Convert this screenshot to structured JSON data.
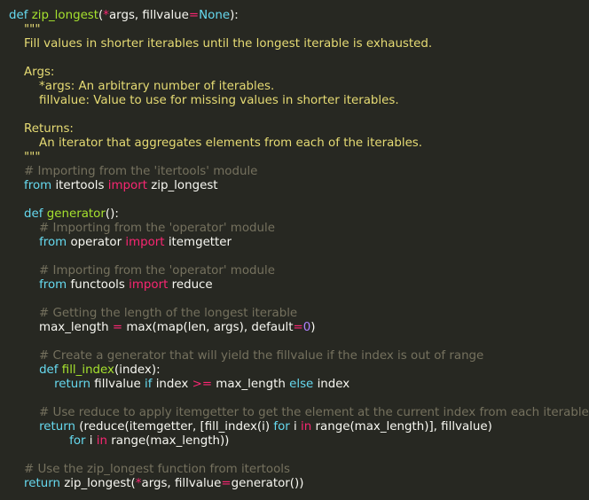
{
  "colors": {
    "background": "#272822",
    "keyword": "#66d9ef",
    "import": "#f92672",
    "function": "#a6e22e",
    "operator": "#f92672",
    "number": "#ae81ff",
    "string": "#e6db74",
    "comment": "#75715e",
    "text": "#f8f8f2"
  },
  "code": {
    "lines": [
      [
        {
          "t": "def ",
          "c": "kw"
        },
        {
          "t": "zip_longest",
          "c": "fn"
        },
        {
          "t": "(",
          "c": "plain"
        },
        {
          "t": "*",
          "c": "op"
        },
        {
          "t": "args, fillvalue",
          "c": "plain"
        },
        {
          "t": "=",
          "c": "op"
        },
        {
          "t": "None",
          "c": "kw"
        },
        {
          "t": "):",
          "c": "plain"
        }
      ],
      [
        {
          "t": "    \"\"\"",
          "c": "str"
        }
      ],
      [
        {
          "t": "    Fill values in shorter iterables until the longest iterable is exhausted.",
          "c": "str"
        }
      ],
      [
        {
          "t": "",
          "c": "plain"
        }
      ],
      [
        {
          "t": "    Args:",
          "c": "str"
        }
      ],
      [
        {
          "t": "        *args: An arbitrary number of iterables.",
          "c": "str"
        }
      ],
      [
        {
          "t": "        fillvalue: Value to use for missing values in shorter iterables.",
          "c": "str"
        }
      ],
      [
        {
          "t": "",
          "c": "plain"
        }
      ],
      [
        {
          "t": "    Returns:",
          "c": "str"
        }
      ],
      [
        {
          "t": "        An iterator that aggregates elements from each of the iterables.",
          "c": "str"
        }
      ],
      [
        {
          "t": "    \"\"\"",
          "c": "str"
        }
      ],
      [
        {
          "t": "    # Importing from the 'itertools' module",
          "c": "cm"
        }
      ],
      [
        {
          "t": "    ",
          "c": "plain"
        },
        {
          "t": "from",
          "c": "kw"
        },
        {
          "t": " itertools ",
          "c": "plain"
        },
        {
          "t": "import",
          "c": "imp"
        },
        {
          "t": " zip_longest",
          "c": "plain"
        }
      ],
      [
        {
          "t": "",
          "c": "plain"
        }
      ],
      [
        {
          "t": "    ",
          "c": "plain"
        },
        {
          "t": "def ",
          "c": "kw"
        },
        {
          "t": "generator",
          "c": "fn"
        },
        {
          "t": "():",
          "c": "plain"
        }
      ],
      [
        {
          "t": "        # Importing from the 'operator' module",
          "c": "cm"
        }
      ],
      [
        {
          "t": "        ",
          "c": "plain"
        },
        {
          "t": "from",
          "c": "kw"
        },
        {
          "t": " operator ",
          "c": "plain"
        },
        {
          "t": "import",
          "c": "imp"
        },
        {
          "t": " itemgetter",
          "c": "plain"
        }
      ],
      [
        {
          "t": "",
          "c": "plain"
        }
      ],
      [
        {
          "t": "        # Importing from the 'operator' module",
          "c": "cm"
        }
      ],
      [
        {
          "t": "        ",
          "c": "plain"
        },
        {
          "t": "from",
          "c": "kw"
        },
        {
          "t": " functools ",
          "c": "plain"
        },
        {
          "t": "import",
          "c": "imp"
        },
        {
          "t": " reduce",
          "c": "plain"
        }
      ],
      [
        {
          "t": "",
          "c": "plain"
        }
      ],
      [
        {
          "t": "        # Getting the length of the longest iterable",
          "c": "cm"
        }
      ],
      [
        {
          "t": "        max_length ",
          "c": "plain"
        },
        {
          "t": "=",
          "c": "op"
        },
        {
          "t": " max(map(len, args), default",
          "c": "plain"
        },
        {
          "t": "=",
          "c": "op"
        },
        {
          "t": "0",
          "c": "num"
        },
        {
          "t": ")",
          "c": "plain"
        }
      ],
      [
        {
          "t": "",
          "c": "plain"
        }
      ],
      [
        {
          "t": "        # Create a generator that will yield the fillvalue if the index is out of range",
          "c": "cm"
        }
      ],
      [
        {
          "t": "        ",
          "c": "plain"
        },
        {
          "t": "def ",
          "c": "kw"
        },
        {
          "t": "fill_index",
          "c": "fn"
        },
        {
          "t": "(index):",
          "c": "plain"
        }
      ],
      [
        {
          "t": "            ",
          "c": "plain"
        },
        {
          "t": "return",
          "c": "kw"
        },
        {
          "t": " fillvalue ",
          "c": "plain"
        },
        {
          "t": "if",
          "c": "kw"
        },
        {
          "t": " index ",
          "c": "plain"
        },
        {
          "t": ">=",
          "c": "op"
        },
        {
          "t": " max_length ",
          "c": "plain"
        },
        {
          "t": "else",
          "c": "kw"
        },
        {
          "t": " index",
          "c": "plain"
        }
      ],
      [
        {
          "t": "",
          "c": "plain"
        }
      ],
      [
        {
          "t": "        # Use reduce to apply itemgetter to get the element at the current index from each iterable",
          "c": "cm"
        }
      ],
      [
        {
          "t": "        ",
          "c": "plain"
        },
        {
          "t": "return",
          "c": "kw"
        },
        {
          "t": " (reduce(itemgetter, [fill_index(i) ",
          "c": "plain"
        },
        {
          "t": "for",
          "c": "kw"
        },
        {
          "t": " i ",
          "c": "plain"
        },
        {
          "t": "in",
          "c": "imp"
        },
        {
          "t": " range(max_length)], fillvalue)",
          "c": "plain"
        }
      ],
      [
        {
          "t": "                ",
          "c": "plain"
        },
        {
          "t": "for",
          "c": "kw"
        },
        {
          "t": " i ",
          "c": "plain"
        },
        {
          "t": "in",
          "c": "imp"
        },
        {
          "t": " range(max_length))",
          "c": "plain"
        }
      ],
      [
        {
          "t": "",
          "c": "plain"
        }
      ],
      [
        {
          "t": "    # Use the zip_longest function from itertools",
          "c": "cm"
        }
      ],
      [
        {
          "t": "    ",
          "c": "plain"
        },
        {
          "t": "return",
          "c": "kw"
        },
        {
          "t": " zip_longest(",
          "c": "plain"
        },
        {
          "t": "*",
          "c": "op"
        },
        {
          "t": "args, fillvalue",
          "c": "plain"
        },
        {
          "t": "=",
          "c": "op"
        },
        {
          "t": "generator())",
          "c": "plain"
        }
      ]
    ]
  }
}
